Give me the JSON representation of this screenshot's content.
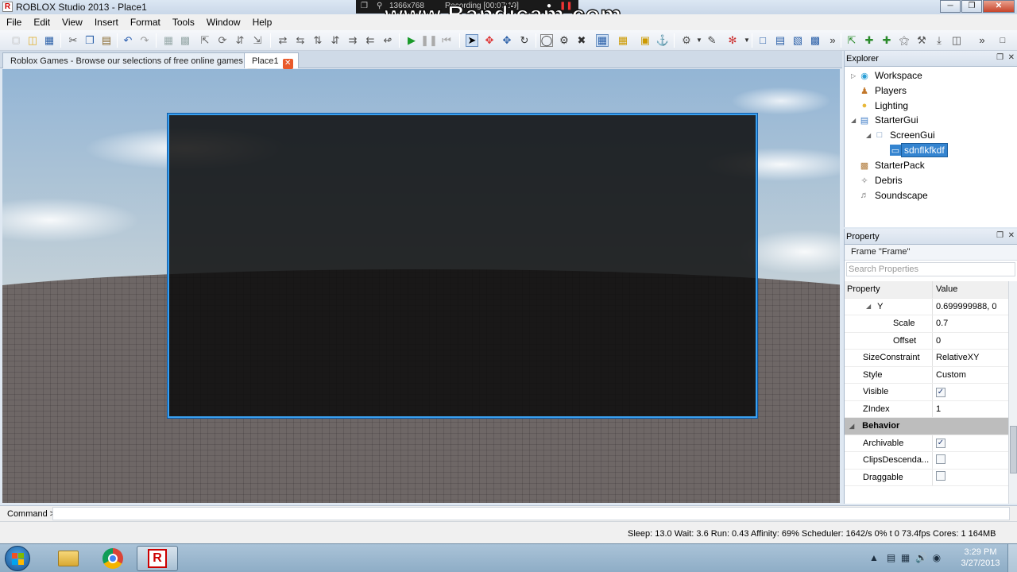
{
  "window": {
    "title": "ROBLOX Studio 2013 - Place1",
    "icon": "roblox-studio-icon",
    "controls": [
      "minimize-icon",
      "restore-icon",
      "close-icon"
    ]
  },
  "recorder": {
    "resolution": "1366x768",
    "status": "Recording [00:07:19]",
    "watermark": "www.Bandicam.com"
  },
  "menu": {
    "items": [
      "File",
      "Edit",
      "View",
      "Insert",
      "Format",
      "Tools",
      "Window",
      "Help"
    ]
  },
  "tabs": [
    {
      "label": "Roblox Games - Browse our selections of free online games",
      "active": false
    },
    {
      "label": "Place1",
      "active": true
    }
  ],
  "explorer": {
    "title": "Explorer",
    "items": [
      {
        "label": "Workspace",
        "icon": "workspace-icon"
      },
      {
        "label": "Players",
        "icon": "players-icon"
      },
      {
        "label": "Lighting",
        "icon": "lighting-icon"
      },
      {
        "label": "StarterGui",
        "icon": "startergui-icon"
      },
      {
        "label": "ScreenGui",
        "icon": "screengui-icon"
      },
      {
        "label": "sdnflkfkdf",
        "icon": "frame-icon",
        "selected": true
      },
      {
        "label": "StarterPack",
        "icon": "starterpack-icon"
      },
      {
        "label": "Debris",
        "icon": "debris-icon"
      },
      {
        "label": "Soundscape",
        "icon": "soundscape-icon"
      }
    ]
  },
  "properties": {
    "title": "Property",
    "object": "Frame \"Frame\"",
    "search_placeholder": "Search Properties",
    "columns": {
      "name": "Property",
      "value": "Value"
    },
    "rows": [
      {
        "name": "Y",
        "value": "0.699999988, 0"
      },
      {
        "name": "Scale",
        "value": "0.7"
      },
      {
        "name": "Offset",
        "value": "0"
      },
      {
        "name": "SizeConstraint",
        "value": "RelativeXY"
      },
      {
        "name": "Style",
        "value": "Custom"
      },
      {
        "name": "Visible",
        "checked": true
      },
      {
        "name": "ZIndex",
        "value": "1"
      },
      {
        "name": "Behavior"
      },
      {
        "name": "Archivable",
        "checked": true
      },
      {
        "name": "ClipsDescenda...",
        "checked": false
      },
      {
        "name": "Draggable",
        "checked": false
      }
    ]
  },
  "command": {
    "label": "Command >"
  },
  "status": {
    "text": "Sleep: 13.0 Wait: 3.6 Run: 0.43 Affinity: 69% Scheduler: 1642/s 0%    t 0    73.4fps    Cores: 1    164MB"
  },
  "taskbar": {
    "apps": [
      "windows-explorer-icon",
      "chrome-icon",
      "roblox-studio-icon"
    ],
    "time": "3:29 PM",
    "date": "3/27/2013"
  },
  "colors": {
    "selection_outline": "#39a0f0",
    "selected_item": "#3484d0",
    "tab_close": "#e95a2b"
  }
}
